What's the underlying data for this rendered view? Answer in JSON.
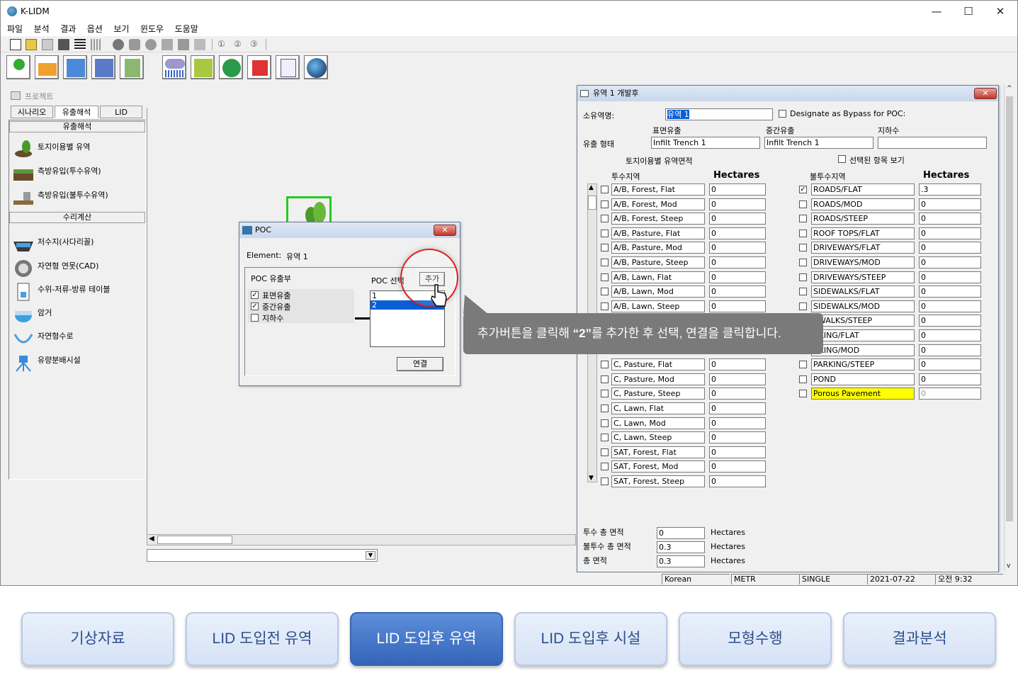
{
  "app": {
    "title": "K-LIDM",
    "min": "—",
    "max": "☐",
    "close": "✕"
  },
  "menu": [
    "파일",
    "분석",
    "결과",
    "옵션",
    "보기",
    "윈도우",
    "도움말"
  ],
  "toolbar1_circles": [
    "①",
    "②",
    "③"
  ],
  "project_panel": {
    "title": "프로젝트",
    "tabs": [
      "시나리오",
      "유출해석",
      "LID"
    ],
    "section1": "유출해석",
    "runoff_items": [
      "토지이용별 유역",
      "측방유입(투수유역)",
      "측방유입(불투수유역)"
    ],
    "section2": "수리계산",
    "hydraulic_items": [
      "저수지(사다리꼴)",
      "자연형 연못(CAD)",
      "수위-저류-방류 테이블",
      "암거",
      "자연형수로",
      "유량분배시설"
    ]
  },
  "poc_dialog": {
    "title": "POC",
    "element_label": "Element:",
    "element_value": "유역  1",
    "group_label": "POC 유출부",
    "options": [
      {
        "label": "표면유출",
        "checked": "✓"
      },
      {
        "label": "중간유출",
        "checked": "✓"
      },
      {
        "label": "지하수",
        "checked": ""
      }
    ],
    "select_label": "POC 선택",
    "add_button": "추가",
    "list": [
      "1",
      "2"
    ],
    "connect_button": "연결"
  },
  "basin_window": {
    "title": "유역  1 개발후",
    "name_label": "소유역명:",
    "name_value": "유역  1",
    "bypass_label": "Designate as Bypass for POC:",
    "surface_label": "표면유출",
    "inter_label": "중간유출",
    "ground_label": "지하수",
    "flow_type_label": "유출 형태",
    "surface_value": "Infilt Trench  1",
    "inter_value": "Infilt Trench  1",
    "ground_value": "",
    "land_area_label": "토지이용별 유역면적",
    "show_selected_label": "선택된 항목 보기",
    "pervious_header": "투수지역",
    "impervious_header": "불투수지역",
    "hectares": "Hectares",
    "pervious": [
      {
        "name": "A/B, Forest, Flat",
        "value": "0"
      },
      {
        "name": "A/B, Forest, Mod",
        "value": "0"
      },
      {
        "name": "A/B, Forest, Steep",
        "value": "0"
      },
      {
        "name": "A/B, Pasture, Flat",
        "value": "0"
      },
      {
        "name": "A/B, Pasture, Mod",
        "value": "0"
      },
      {
        "name": "A/B, Pasture, Steep",
        "value": "0"
      },
      {
        "name": "A/B, Lawn, Flat",
        "value": "0"
      },
      {
        "name": "A/B, Lawn, Mod",
        "value": "0"
      },
      {
        "name": "A/B, Lawn, Steep",
        "value": "0"
      },
      {
        "name": "",
        "value": ""
      },
      {
        "name": "",
        "value": ""
      },
      {
        "name": "",
        "value": ""
      },
      {
        "name": "C, Pasture, Flat",
        "value": "0"
      },
      {
        "name": "C, Pasture, Mod",
        "value": "0"
      },
      {
        "name": "C, Pasture, Steep",
        "value": "0"
      },
      {
        "name": "C, Lawn, Flat",
        "value": "0"
      },
      {
        "name": "C, Lawn, Mod",
        "value": "0"
      },
      {
        "name": "C, Lawn, Steep",
        "value": "0"
      },
      {
        "name": "SAT, Forest, Flat",
        "value": "0"
      },
      {
        "name": "SAT, Forest, Mod",
        "value": "0"
      },
      {
        "name": "SAT, Forest, Steep",
        "value": "0"
      }
    ],
    "impervious": [
      {
        "name": "ROADS/FLAT",
        "value": ".3",
        "checked": "✓"
      },
      {
        "name": "ROADS/MOD",
        "value": "0",
        "checked": ""
      },
      {
        "name": "ROADS/STEEP",
        "value": "0",
        "checked": ""
      },
      {
        "name": "ROOF TOPS/FLAT",
        "value": "0",
        "checked": ""
      },
      {
        "name": "DRIVEWAYS/FLAT",
        "value": "0",
        "checked": ""
      },
      {
        "name": "DRIVEWAYS/MOD",
        "value": "0",
        "checked": ""
      },
      {
        "name": "DRIVEWAYS/STEEP",
        "value": "0",
        "checked": ""
      },
      {
        "name": "SIDEWALKS/FLAT",
        "value": "0",
        "checked": ""
      },
      {
        "name": "SIDEWALKS/MOD",
        "value": "0",
        "checked": ""
      },
      {
        "name": "EWALKS/STEEP",
        "value": "0",
        "checked": ""
      },
      {
        "name": "RKING/FLAT",
        "value": "0",
        "checked": ""
      },
      {
        "name": "RKING/MOD",
        "value": "0",
        "checked": ""
      },
      {
        "name": "PARKING/STEEP",
        "value": "0",
        "checked": ""
      },
      {
        "name": "POND",
        "value": "0",
        "checked": ""
      },
      {
        "name": "Porous Pavement",
        "value": "0",
        "checked": ""
      }
    ],
    "totals": [
      {
        "label": "투수 총 면적",
        "value": "0",
        "unit": "Hectares"
      },
      {
        "label": "불투수 총 면적",
        "value": "0.3",
        "unit": "Hectares"
      },
      {
        "label": "총 면적",
        "value": "0.3",
        "unit": "Hectares"
      }
    ]
  },
  "status": {
    "lang": "Korean",
    "unit": "METR",
    "mode": "SINGLE",
    "date": "2021-07-22",
    "time": "오전 9:32"
  },
  "callout": {
    "pre": "추가버튼을 클릭해 ",
    "highlight": "“2”",
    "post": "를 추가한 후 선택, 연결을 클릭합니다."
  },
  "nav": [
    "기상자료",
    "LID 도입전 유역",
    "LID 도입후 유역",
    "LID 도입후 시설",
    "모형수행",
    "결과분석"
  ],
  "colors": {
    "accent": "#3464b8",
    "highlight_field": "#ffff00",
    "selection": "#0a5fd6",
    "green_frame": "#22cc22",
    "callout_ring": "#e02020"
  }
}
